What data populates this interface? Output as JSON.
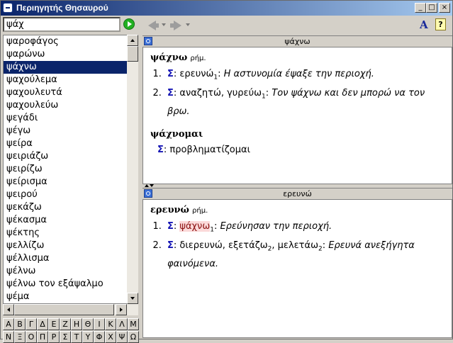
{
  "window": {
    "title": "Περιηγητής Θησαυρού",
    "controls": {
      "minimize": "_",
      "maximize": "□",
      "close": "×"
    }
  },
  "search": {
    "value": "ψάχ"
  },
  "word_list": [
    "ψαροφάγος",
    "ψαρώνω",
    "ψάχνω",
    "ψαχούλεμα",
    "ψαχουλευτά",
    "ψαχουλεύω",
    "ψεγάδι",
    "ψέγω",
    "ψείρα",
    "ψειριάζω",
    "ψειρίζω",
    "ψείρισμα",
    "ψειρού",
    "ψεκάζω",
    "ψέκασμα",
    "ψέκτης",
    "ψελλίζω",
    "ψέλλισμα",
    "ψέλνω",
    "ψέλνω τον εξάψαλμο",
    "ψέμα"
  ],
  "selected_word_index": 2,
  "alphabet_row1": [
    "Α",
    "Β",
    "Γ",
    "Δ",
    "Ε",
    "Ζ",
    "Η",
    "Θ",
    "Ι",
    "Κ",
    "Λ",
    "Μ"
  ],
  "alphabet_row2": [
    "Ν",
    "Ξ",
    "Ο",
    "Π",
    "Ρ",
    "Σ",
    "Τ",
    "Υ",
    "Φ",
    "Χ",
    "Ψ",
    "Ω"
  ],
  "toolbar": {
    "font_icon": "A",
    "help_icon": "?"
  },
  "panel1": {
    "header": "ψάχνω",
    "headword": "ψάχνω",
    "pos": "ρήμ.",
    "senses": [
      {
        "syn": "Σ",
        "words": "ερευνώ",
        "sub": "1",
        "example": "Η αστυνομία έψαξε την περιοχή."
      },
      {
        "syn": "Σ",
        "words": "αναζητώ, γυρεύω",
        "sub": "1",
        "example": "Τον ψάχνω και δεν μπορώ να τον βρω."
      }
    ],
    "sub_headword": "ψάχνομαι",
    "sub_sense": {
      "syn": "Σ",
      "words": "προβληματίζομαι"
    }
  },
  "panel2": {
    "header": "ερευνώ",
    "headword": "ερευνώ",
    "pos": "ρήμ.",
    "senses": [
      {
        "syn": "Σ",
        "hl_word": "ψάχνω",
        "sub": "1",
        "example": "Ερεύνησαν την περιοχή."
      },
      {
        "syn": "Σ",
        "words_a": "διερευνώ, εξετάζω",
        "sub_a": "2",
        "words_b": "μελετάω",
        "sub_b": "2",
        "example": "Ερευνά ανεξήγητα φαινόμενα."
      }
    ]
  }
}
